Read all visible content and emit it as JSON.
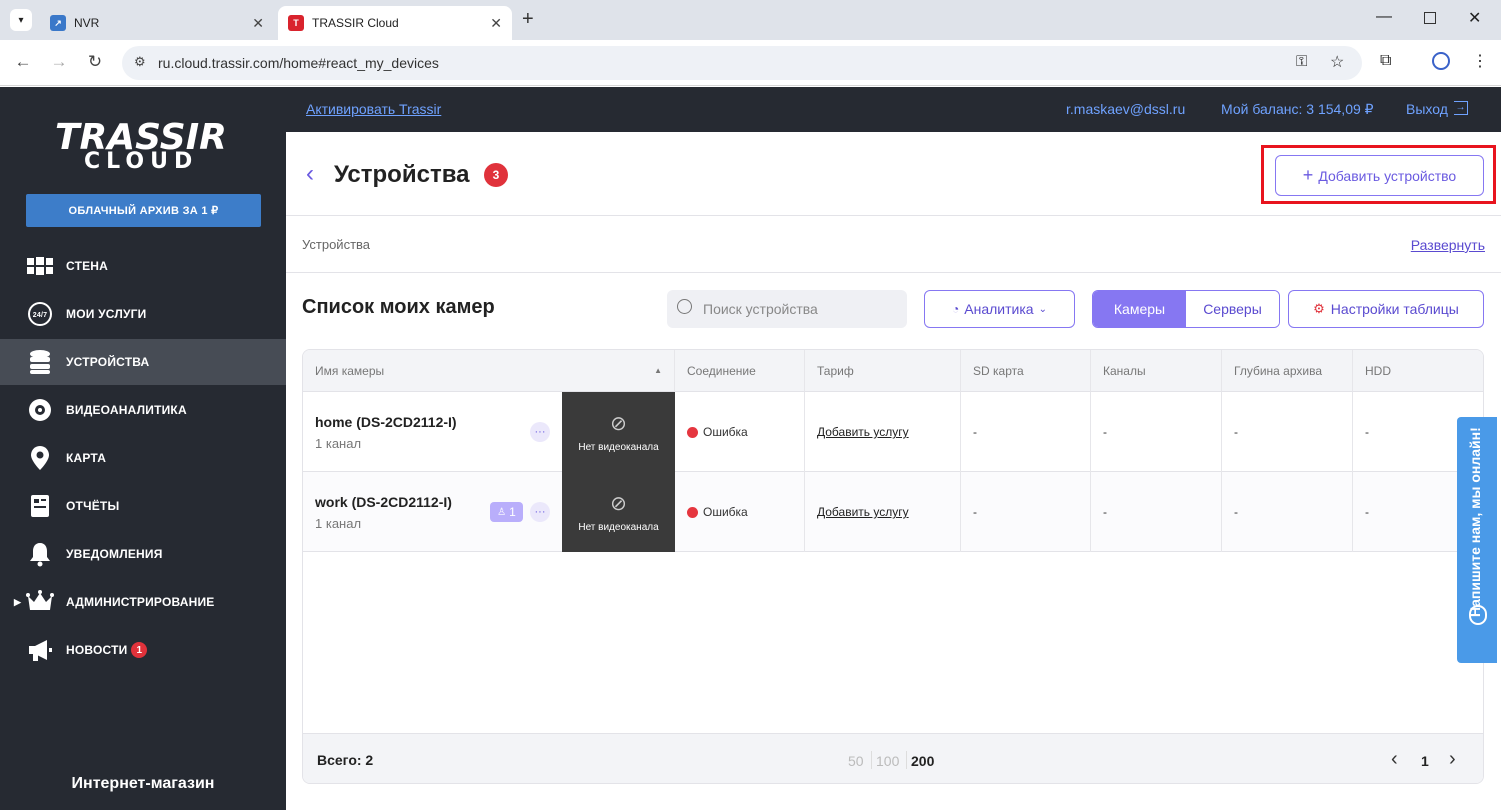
{
  "browser": {
    "tabs": [
      {
        "label": "NVR",
        "active": false
      },
      {
        "label": "TRASSIR Cloud",
        "active": true
      }
    ],
    "url": "ru.cloud.trassir.com/home#react_my_devices"
  },
  "sidebar": {
    "logo_line1": "TRASSIR",
    "logo_line2": "CLOUD",
    "promo_label": "ОБЛАЧНЫЙ АРХИВ ЗА 1 ₽",
    "items": [
      {
        "label": "СТЕНА",
        "icon": "wall-icon",
        "active": false
      },
      {
        "label": "МОИ УСЛУГИ",
        "icon": "services-24-7-icon",
        "active": false
      },
      {
        "label": "УСТРОЙСТВА",
        "icon": "database-icon",
        "active": true
      },
      {
        "label": "ВИДЕОАНАЛИТИКА",
        "icon": "brain-icon",
        "active": false
      },
      {
        "label": "КАРТА",
        "icon": "map-pin-icon",
        "active": false
      },
      {
        "label": "ОТЧЁТЫ",
        "icon": "report-icon",
        "active": false
      },
      {
        "label": "УВЕДОМЛЕНИЯ",
        "icon": "bell-icon",
        "active": false
      },
      {
        "label": "АДМИНИСТРИРОВАНИЕ",
        "icon": "crown-icon",
        "active": false
      },
      {
        "label": "НОВОСТИ",
        "icon": "megaphone-icon",
        "active": false,
        "badge": "1"
      }
    ],
    "shop_label": "Интернет-магазин"
  },
  "topbar": {
    "activate_link": "Активировать Trassir",
    "email": "r.maskaev@dssl.ru",
    "balance": "Мой баланс: 3 154,09 ₽",
    "logout": "Выход"
  },
  "page": {
    "title": "Устройства",
    "count_badge": "3",
    "add_button": "Добавить устройство",
    "breadcrumb": "Устройства",
    "expand_link": "Развернуть",
    "list_title": "Список моих камер",
    "search_placeholder": "Поиск устройства",
    "analytics_button": "Аналитика",
    "seg_cameras": "Камеры",
    "seg_servers": "Серверы",
    "table_settings": "Настройки таблицы"
  },
  "table": {
    "columns": [
      "Имя камеры",
      "Соединение",
      "Тариф",
      "SD карта",
      "Каналы",
      "Глубина архива",
      "HDD"
    ],
    "rows": [
      {
        "name": "home (DS-2CD2112-I)",
        "channels": "1 канал",
        "thumb": "Нет видеоканала",
        "connection": "Ошибка",
        "tariff": "Добавить услугу",
        "sd": "-",
        "ch": "-",
        "depth": "-",
        "hdd": "-",
        "users": ""
      },
      {
        "name": "work (DS-2CD2112-I)",
        "channels": "1 канал",
        "thumb": "Нет видеоканала",
        "connection": "Ошибка",
        "tariff": "Добавить услугу",
        "sd": "-",
        "ch": "-",
        "depth": "-",
        "hdd": "-",
        "users": "1"
      }
    ],
    "total": "Всего: 2",
    "page_sizes": [
      "50",
      "100",
      "200"
    ],
    "selected_page_size": "200",
    "current_page": "1"
  },
  "chat_widget": "Напишите нам, мы онлайн!",
  "colors": {
    "accent": "#6a5ae0",
    "sidebar_bg": "#262a32",
    "error": "#e5363f",
    "highlight_box": "#e8141e"
  }
}
